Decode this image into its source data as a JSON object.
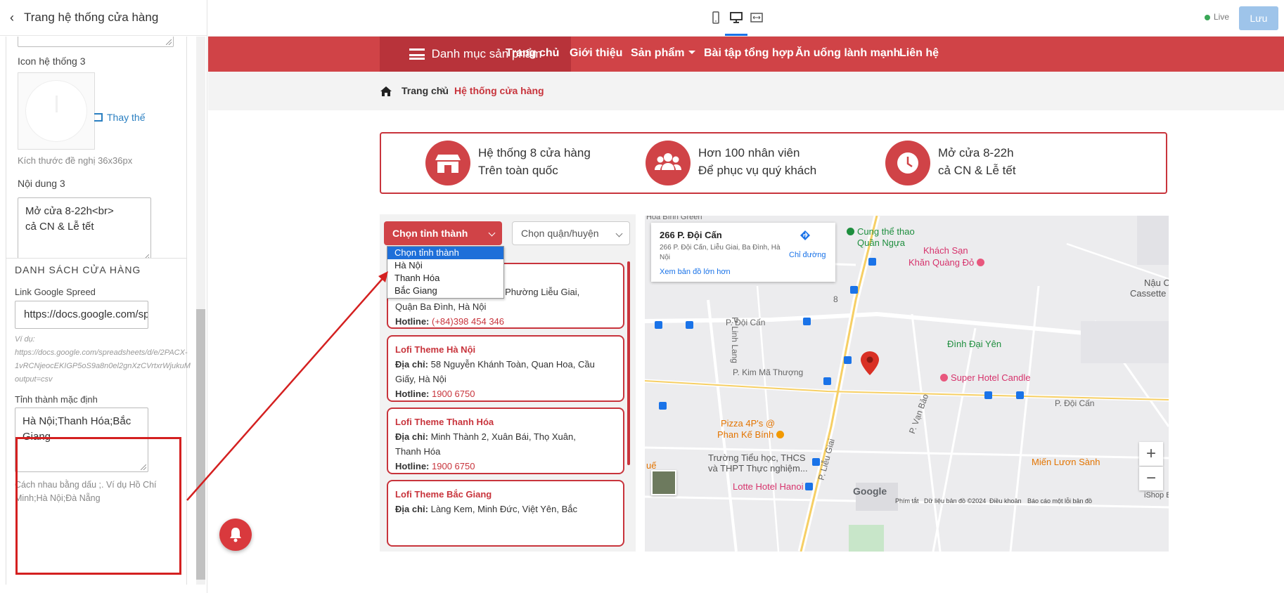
{
  "panel": {
    "title": "Trang hệ thống cửa hàng",
    "icon3_label": "Icon hệ thống 3",
    "replace_label": "Thay thế",
    "size_hint": "Kích thước đề nghị 36x36px",
    "content3_label": "Nội dung 3",
    "content3_line1": "Mở cửa 8-22h<br>",
    "content3_line2": "cả CN & Lễ tết",
    "section_title": "DANH SÁCH CỬA HÀNG",
    "sheet_label": "Link Google Spreed",
    "sheet_value": "https://docs.google.com/spreadsheets",
    "sheet_example_1": "Ví dụ:",
    "sheet_example_2": "https://docs.google.com/spreadsheets/d/e/2PACX-",
    "sheet_example_3": "1vRCNjeocEKIGP5oS9a8n0el2gnXzCVrtxrWjukuM",
    "sheet_example_4": "output=csv",
    "default_province_label": "Tỉnh thành mặc định",
    "default_province_value": "Hà Nội;Thanh Hóa;Bắc Giang",
    "separator_hint": "Cách nhau bằng dấu ;. Ví dụ Hồ Chí Minh;Hà Nội;Đà Nẵng"
  },
  "toolbar": {
    "live_label": "Live",
    "save_label": "Lưu"
  },
  "nav": {
    "category_menu": "Danh mục sản phẩm",
    "items": [
      "Trang chủ",
      "Giới thiệu",
      "Sản phẩm",
      "Bài tập tổng hợp",
      "Ăn uống lành mạnh",
      "Liên hệ"
    ]
  },
  "breadcrumb": {
    "home": "Trang chủ",
    "current": "Hệ thống cửa hàng"
  },
  "features": [
    {
      "line1": "Hệ thống 8 cửa hàng",
      "line2": "Trên toàn quốc",
      "icon": "store-icon"
    },
    {
      "line1": "Hơn 100 nhân viên",
      "line2": "Để phục vụ quý khách",
      "icon": "users-icon"
    },
    {
      "line1": "Mở cửa 8-22h",
      "line2": "cả CN & Lễ tết",
      "icon": "clock-icon"
    }
  ],
  "filters": {
    "province_label": "Chọn tỉnh thành",
    "district_label": "Chọn quận/huyện",
    "province_options": [
      "Chọn tỉnh thành",
      "Hà Nội",
      "Thanh Hóa",
      "Bắc Giang"
    ]
  },
  "stores": [
    {
      "name": "",
      "address_label": "",
      "address": "Cấn, Phường Liễu Giai,",
      "address2": "Quận Ba Đình, Hà Nội",
      "hotline_label": "Hotline:",
      "hotline": "(+84)398 454 346"
    },
    {
      "name": "Lofi Theme Hà Nội",
      "address_label": "Địa chỉ:",
      "address": "58 Nguyễn Khánh Toàn, Quan Hoa, Cầu",
      "address2": "Giấy, Hà Nội",
      "hotline_label": "Hotline:",
      "hotline": "1900 6750"
    },
    {
      "name": "Lofi Theme Thanh Hóa",
      "address_label": "Địa chỉ:",
      "address": "Minh Thành 2, Xuân Bái, Thọ Xuân,",
      "address2": "Thanh Hóa",
      "hotline_label": "Hotline:",
      "hotline": "1900 6750"
    },
    {
      "name": "Lofi Theme Bắc Giang",
      "address_label": "Địa chỉ:",
      "address": "Làng Kem, Minh Đức, Việt Yên, Bắc",
      "address2": "",
      "hotline_label": "",
      "hotline": ""
    }
  ],
  "map": {
    "info_title": "266 P. Đội Cấn",
    "info_address": "266 P. Đội Cấn, Liễu Giai, Ba Đình, Hà Nội",
    "directions": "Chỉ đường",
    "larger_map": "Xem bản đồ lớn hơn",
    "labels": {
      "hoa_binh_green": "Hòa Bình Green",
      "sports": "Cung thể thao",
      "quan_ngua": "Quần Ngựa",
      "hotel1": "Khách Sạn",
      "hotel1b": "Khăn Quàng Đỏ",
      "nau": "Nậu C",
      "cassette": "Cassette Wor",
      "doi_can_street": "P. Đội Cấn",
      "linh_lang": "P. Linh Lang",
      "dinh_dai_yen": "Đình Đại Yên",
      "kim_ma": "P. Kim Mã Thượng",
      "super_hotel": "Super Hotel Candle",
      "van_bao": "P. Vạn Bảo",
      "doi_can_2": "P. Đội Cấn",
      "pizza": "Pizza 4P's @",
      "pizza2": "Phan Kế Bính",
      "school1": "Trường Tiểu học, THCS",
      "school2": "và THPT Thực nghiệm...",
      "lieu_giai": "P. Liễu Giai",
      "mien_luon": "Miến Lươn Sành",
      "lotte": "Lotte Hotel Hanoi",
      "number_8": "8",
      "que": "uế",
      "ishop": "iShop B"
    },
    "footer": [
      "Phím tắt",
      "Dữ liệu bản đồ ©2024",
      "Điều khoản",
      "Báo cáo một lỗi bản đồ"
    ],
    "google": "Google",
    "zoom_in": "+",
    "zoom_out": "−"
  },
  "colors": {
    "brand_red": "#d04347",
    "dark_red": "#b8333a",
    "save_button": "#9ec4ea",
    "annotation_red": "#d42020"
  }
}
